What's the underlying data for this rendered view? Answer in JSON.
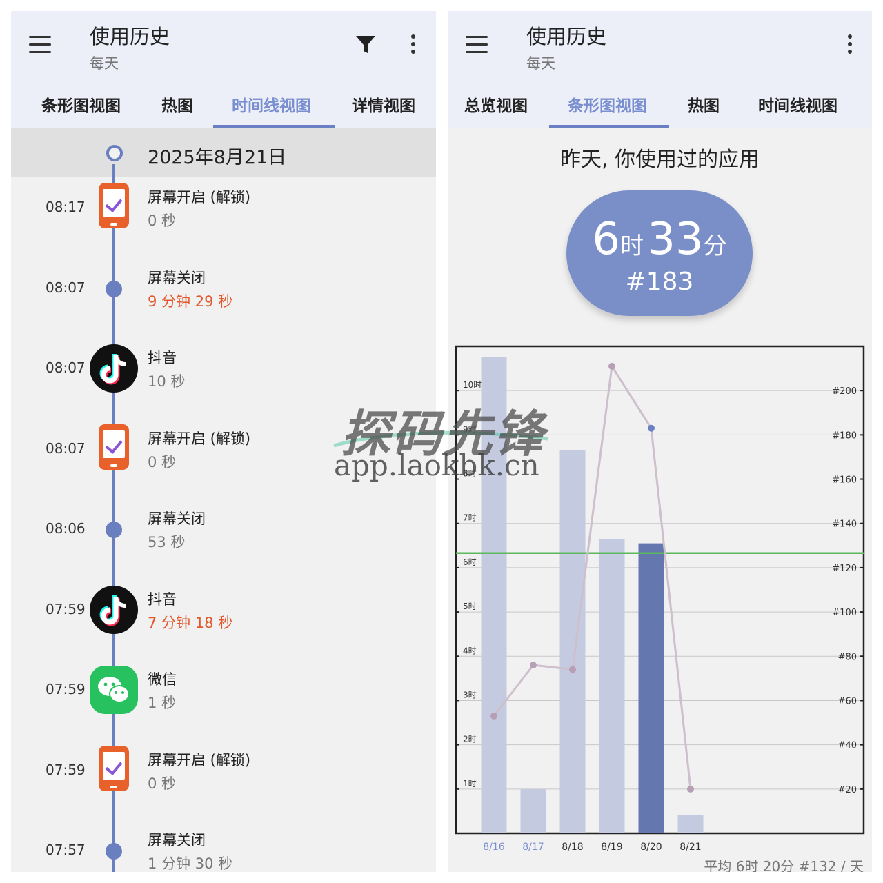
{
  "left": {
    "title": "使用历史",
    "subtitle": "每天",
    "tabs": [
      "条形图视图",
      "热图",
      "时间线视图",
      "详情视图"
    ],
    "active_tab": 2,
    "date": "2025年8月21日",
    "items": [
      {
        "time": "08:17",
        "name": "屏幕开启 (解锁)",
        "duration": "0 秒",
        "icon": "phone-unlock-icon",
        "highlight": false
      },
      {
        "time": "08:07",
        "name": "屏幕关闭",
        "duration": "9 分钟 29 秒",
        "icon": "dot",
        "highlight": true
      },
      {
        "time": "08:07",
        "name": "抖音",
        "duration": "10 秒",
        "icon": "tiktok-icon",
        "highlight": false
      },
      {
        "time": "08:07",
        "name": "屏幕开启 (解锁)",
        "duration": "0 秒",
        "icon": "phone-unlock-icon",
        "highlight": false
      },
      {
        "time": "08:06",
        "name": "屏幕关闭",
        "duration": "53 秒",
        "icon": "dot",
        "highlight": false
      },
      {
        "time": "07:59",
        "name": "抖音",
        "duration": "7 分钟 18 秒",
        "icon": "tiktok-icon",
        "highlight": true
      },
      {
        "time": "07:59",
        "name": "微信",
        "duration": "1 秒",
        "icon": "wechat-icon",
        "highlight": false
      },
      {
        "time": "07:59",
        "name": "屏幕开启 (解锁)",
        "duration": "0 秒",
        "icon": "phone-unlock-icon",
        "highlight": false
      },
      {
        "time": "07:57",
        "name": "屏幕关闭",
        "duration": "1 分钟 30 秒",
        "icon": "dot",
        "highlight": false
      }
    ]
  },
  "right": {
    "title": "使用历史",
    "subtitle": "每天",
    "tabs": [
      "总览视图",
      "条形图视图",
      "热图",
      "时间线视图"
    ],
    "active_tab": 1,
    "heading": "昨天, 你使用过的应用",
    "summary": {
      "hours": "6",
      "hour_unit": "时",
      "minutes": "33",
      "minute_unit": "分",
      "rank": "#183"
    },
    "footer": "平均 6时 20分 #132 / 天"
  },
  "watermark": {
    "title": "探码先锋",
    "url": "app.laokbk.cn"
  },
  "colors": {
    "accent": "#6b80c4",
    "bar": "#c4cbe0",
    "bar_selected": "#6477ae",
    "average_line": "#5cb85c",
    "warn": "#e0582b",
    "rank_line": "#cdbfcc"
  },
  "chart_data": {
    "type": "bar",
    "categories": [
      "8/16",
      "8/17",
      "8/18",
      "8/19",
      "8/20",
      "8/21"
    ],
    "selected_index": 4,
    "series": [
      {
        "name": "",
        "values": [
          10.75,
          1.0,
          8.65,
          6.65,
          6.55,
          0.42
        ],
        "axis": "left"
      },
      {
        "type": "line",
        "name": "",
        "values": [
          53,
          76,
          74,
          211,
          183,
          20
        ],
        "axis": "right"
      }
    ],
    "average_hours": 6.33,
    "left_axis": {
      "ticks": [
        "1时",
        "2时",
        "3时",
        "4时",
        "5时",
        "6时",
        "7时",
        "8时",
        "9时",
        "10时"
      ],
      "ylim": [
        0,
        11
      ]
    },
    "right_axis": {
      "ticks": [
        "#20",
        "#40",
        "#60",
        "#80",
        "#100",
        "#120",
        "#140",
        "#160",
        "#180",
        "#200"
      ],
      "ylim": [
        0,
        220
      ]
    },
    "grid": true
  }
}
